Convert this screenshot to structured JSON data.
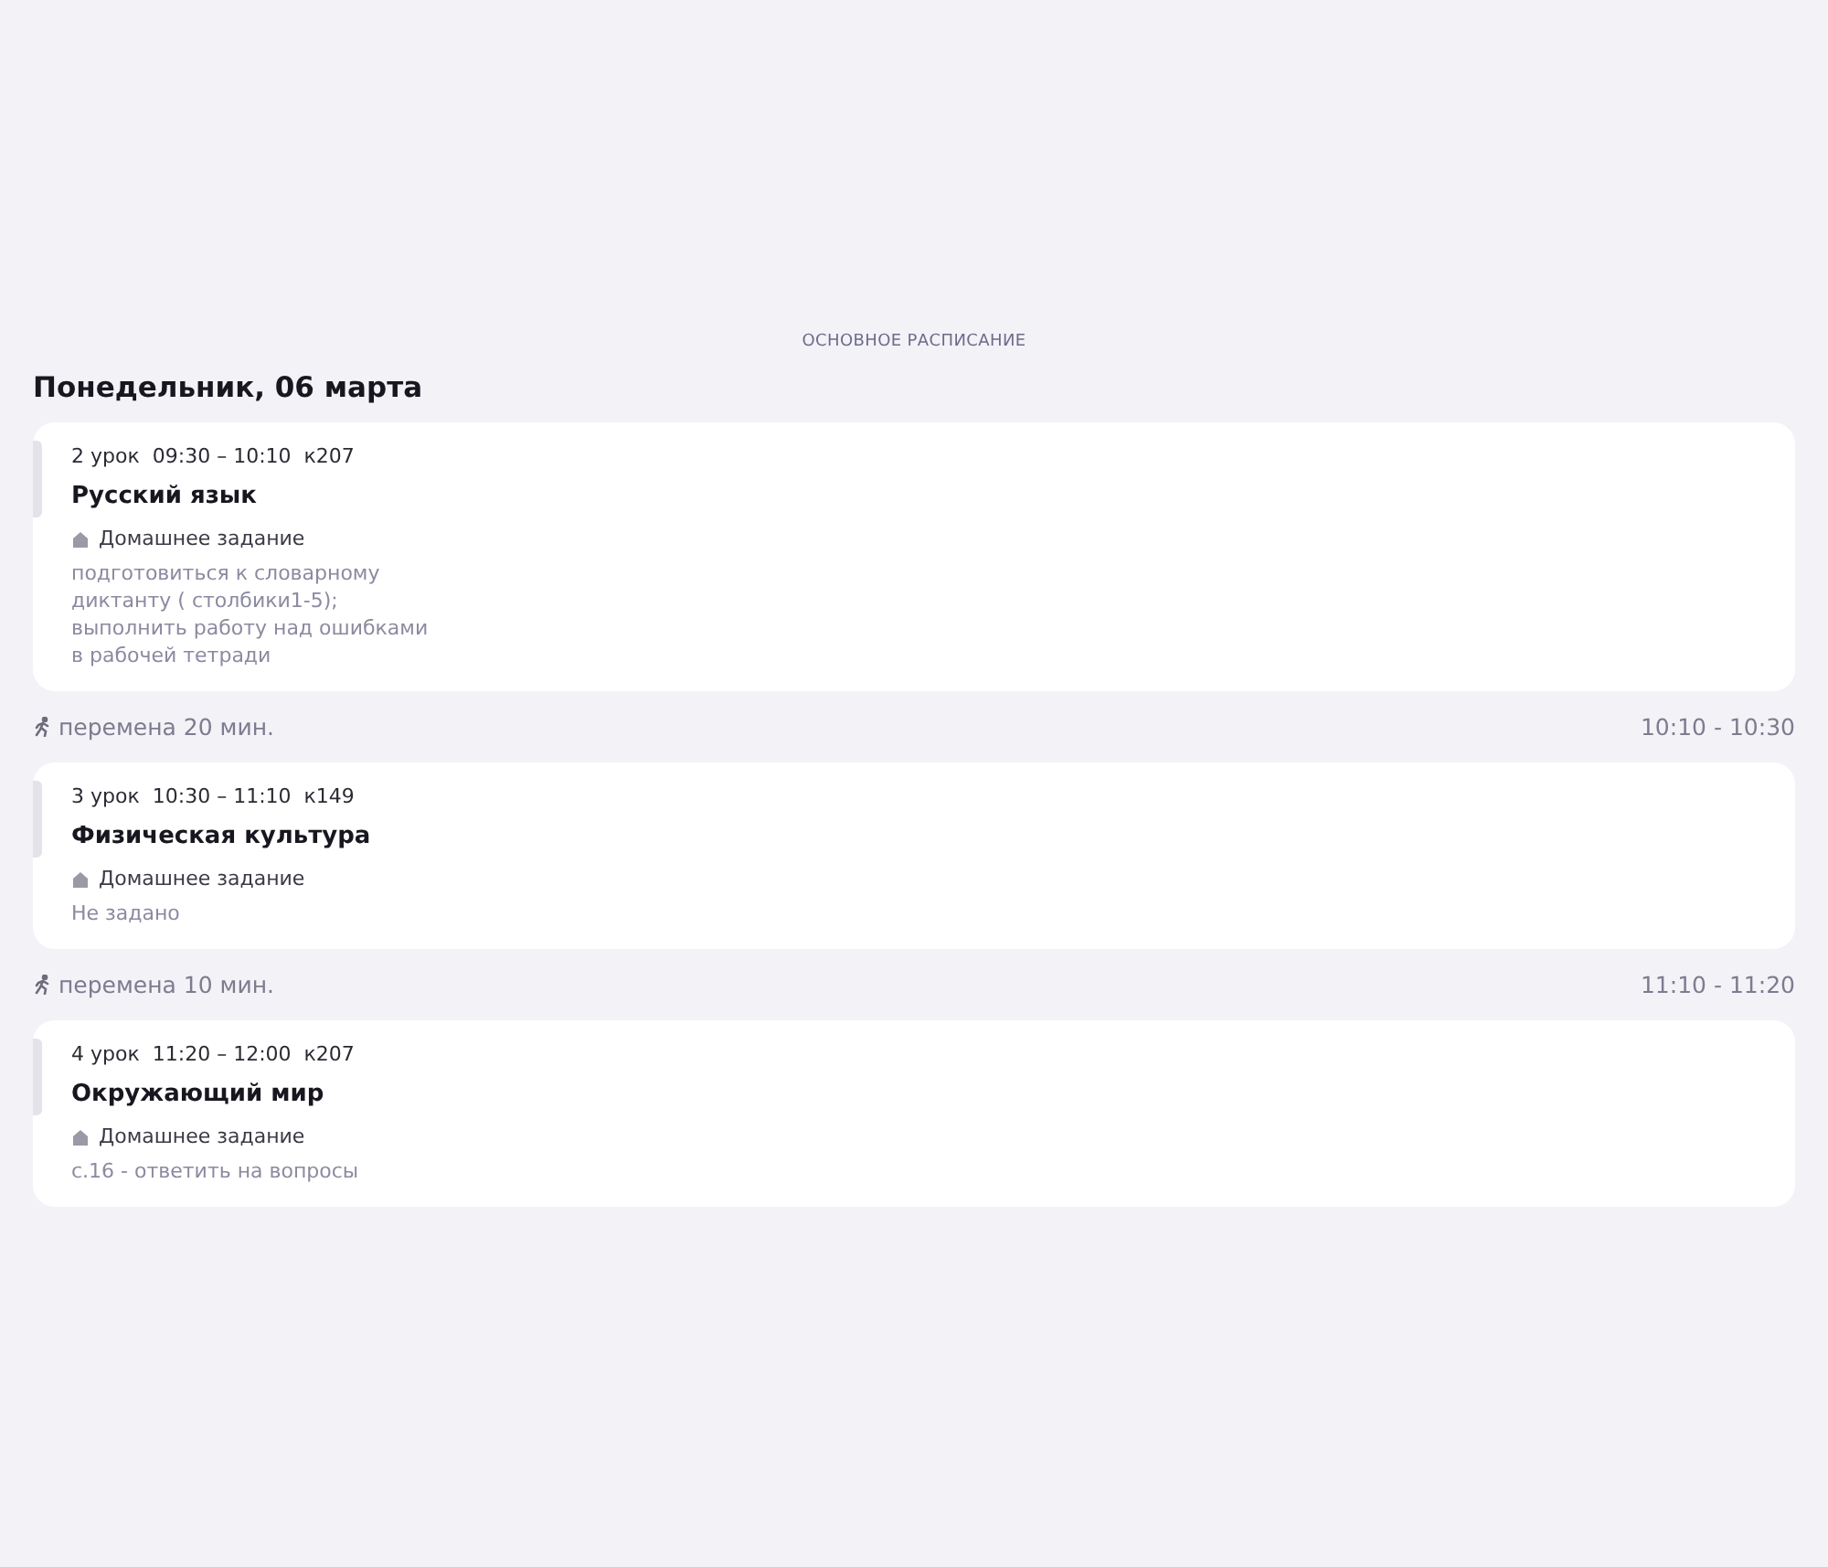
{
  "section_label": "ОСНОВНОЕ РАСПИСАНИЕ",
  "day_title": "Понедельник, 06 марта",
  "items": [
    {
      "kind": "lesson",
      "number": "2 урок",
      "time": "09:30 – 10:10",
      "room": "к207",
      "subject": "Русский язык",
      "homework_label": "Домашнее задание",
      "homework": "подготовиться к словарному\nдиктанту ( столбики1-5);\nвыполнить работу над ошибками\nв рабочей тетради"
    },
    {
      "kind": "break",
      "label": "перемена 20 мин.",
      "time": "10:10 - 10:30"
    },
    {
      "kind": "lesson",
      "number": "3 урок",
      "time": "10:30 – 11:10",
      "room": "к149",
      "subject": "Физическая культура",
      "homework_label": "Домашнее задание",
      "homework": "Не задано"
    },
    {
      "kind": "break",
      "label": "перемена 10 мин.",
      "time": "11:10 - 11:20"
    },
    {
      "kind": "lesson",
      "number": "4 урок",
      "time": "11:20 – 12:00",
      "room": "к207",
      "subject": "Окружающий мир",
      "homework_label": "Домашнее задание",
      "homework": "с.16 - ответить на вопросы"
    }
  ]
}
